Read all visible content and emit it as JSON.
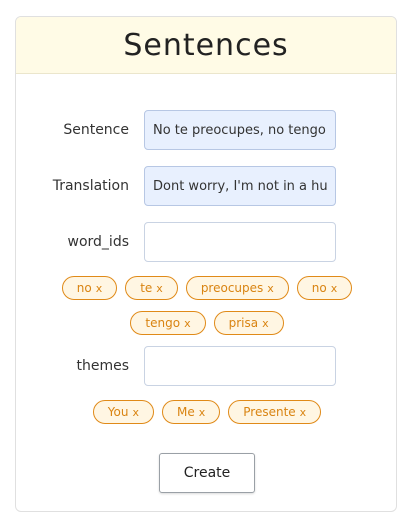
{
  "header": {
    "title": "Sentences"
  },
  "form": {
    "sentence": {
      "label": "Sentence",
      "value": "No te preocupes, no tengo prisa"
    },
    "translation": {
      "label": "Translation",
      "value": "Dont worry, I'm not in a hurry"
    },
    "word_ids": {
      "label": "word_ids",
      "value": "",
      "tags": [
        "no",
        "te",
        "preocupes",
        "no",
        "tengo",
        "prisa"
      ]
    },
    "themes": {
      "label": "themes",
      "value": "",
      "tags": [
        "You",
        "Me",
        "Presente"
      ]
    },
    "remove_glyph": "x",
    "create_label": "Create"
  },
  "colors": {
    "header_bg": "#fffbe6",
    "filled_input_bg": "#e8f0fe",
    "tag_accent": "#e08a18"
  }
}
